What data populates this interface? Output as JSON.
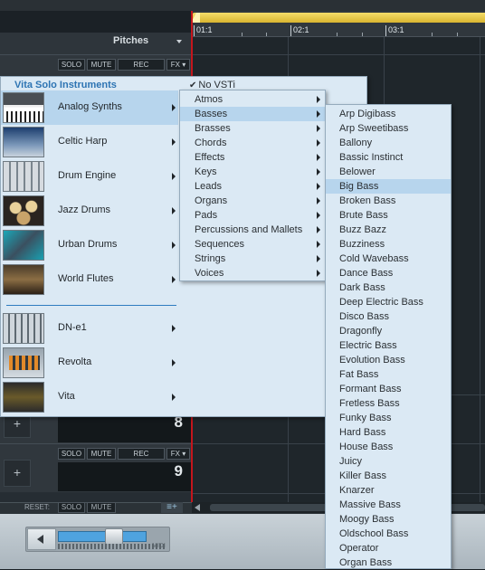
{
  "timeline": {
    "ticks": [
      "01:1",
      "02:1",
      "03:1"
    ],
    "header_label": "Pitches"
  },
  "tracks": {
    "buttons": {
      "solo": "SOLO",
      "mute": "MUTE",
      "rec": "REC",
      "fx": "FX ▾"
    },
    "numbers": [
      "8",
      "9"
    ],
    "plus": "+"
  },
  "bottom": {
    "reset": "RESET:",
    "solo": "SOLO",
    "mute": "MUTE",
    "midi": "MIDI"
  },
  "transport": {
    "position_fraction": 0.45
  },
  "menu": {
    "title": "Vita Solo Instruments",
    "no_vsti": "No VSTi",
    "instruments": [
      {
        "label": "Analog Synths",
        "icon": "synth-thumbnail"
      },
      {
        "label": "Celtic Harp",
        "icon": "harp-thumbnail"
      },
      {
        "label": "Drum Engine",
        "icon": "drum-engine-thumbnail"
      },
      {
        "label": "Jazz Drums",
        "icon": "jazz-drums-thumbnail"
      },
      {
        "label": "Urban Drums",
        "icon": "urban-drums-thumbnail"
      },
      {
        "label": "World Flutes",
        "icon": "flutes-thumbnail"
      }
    ],
    "plugins": [
      {
        "label": "DN-e1",
        "icon": "dn-e1-thumbnail"
      },
      {
        "label": "Revolta",
        "icon": "revolta-thumbnail"
      },
      {
        "label": "Vita",
        "icon": "vita-thumbnail"
      }
    ],
    "selected_instrument": "Analog Synths",
    "categories": [
      "Atmos",
      "Basses",
      "Brasses",
      "Chords",
      "Effects",
      "Keys",
      "Leads",
      "Organs",
      "Pads",
      "Percussions and Mallets",
      "Sequences",
      "Strings",
      "Voices"
    ],
    "selected_category": "Basses",
    "basses": [
      "Arp Digibass",
      "Arp Sweetibass",
      "Ballony",
      "Bassic Instinct",
      "Belower",
      "Big Bass",
      "Broken Bass",
      "Brute Bass",
      "Buzz Bazz",
      "Buzziness",
      "Cold Wavebass",
      "Dance Bass",
      "Dark Bass",
      "Deep Electric Bass",
      "Disco Bass",
      "Dragonfly",
      "Electric Bass",
      "Evolution Bass",
      "Fat Bass",
      "Formant Bass",
      "Fretless Bass",
      "Funky Bass",
      "Hard Bass",
      "House Bass",
      "Juicy",
      "Killer Bass",
      "Knarzer",
      "Massive Bass",
      "Moogy Bass",
      "Oldschool Bass",
      "Operator",
      "Organ Bass"
    ],
    "selected_bass": "Big Bass"
  }
}
